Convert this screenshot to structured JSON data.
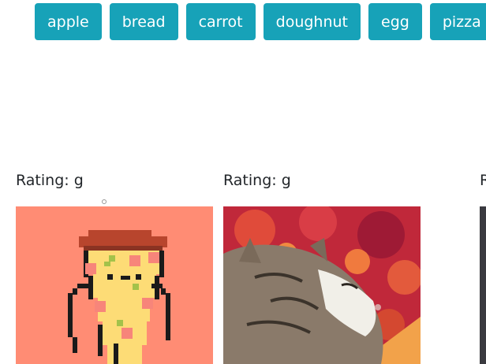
{
  "tag_buttons": [
    {
      "label": "apple"
    },
    {
      "label": "bread"
    },
    {
      "label": "carrot"
    },
    {
      "label": "doughnut"
    },
    {
      "label": "egg"
    },
    {
      "label": "pizza"
    }
  ],
  "results": [
    {
      "rating": "Rating: g",
      "image": "pixel-pizza-slice-gif"
    },
    {
      "rating": "Rating: g",
      "image": "cat-on-pizza-gif"
    },
    {
      "rating": "R",
      "image": "partial-gif"
    }
  ],
  "colors": {
    "button_bg": "#17a2b8",
    "button_text": "#ffffff",
    "pizza_bg": "#ff8c74"
  }
}
